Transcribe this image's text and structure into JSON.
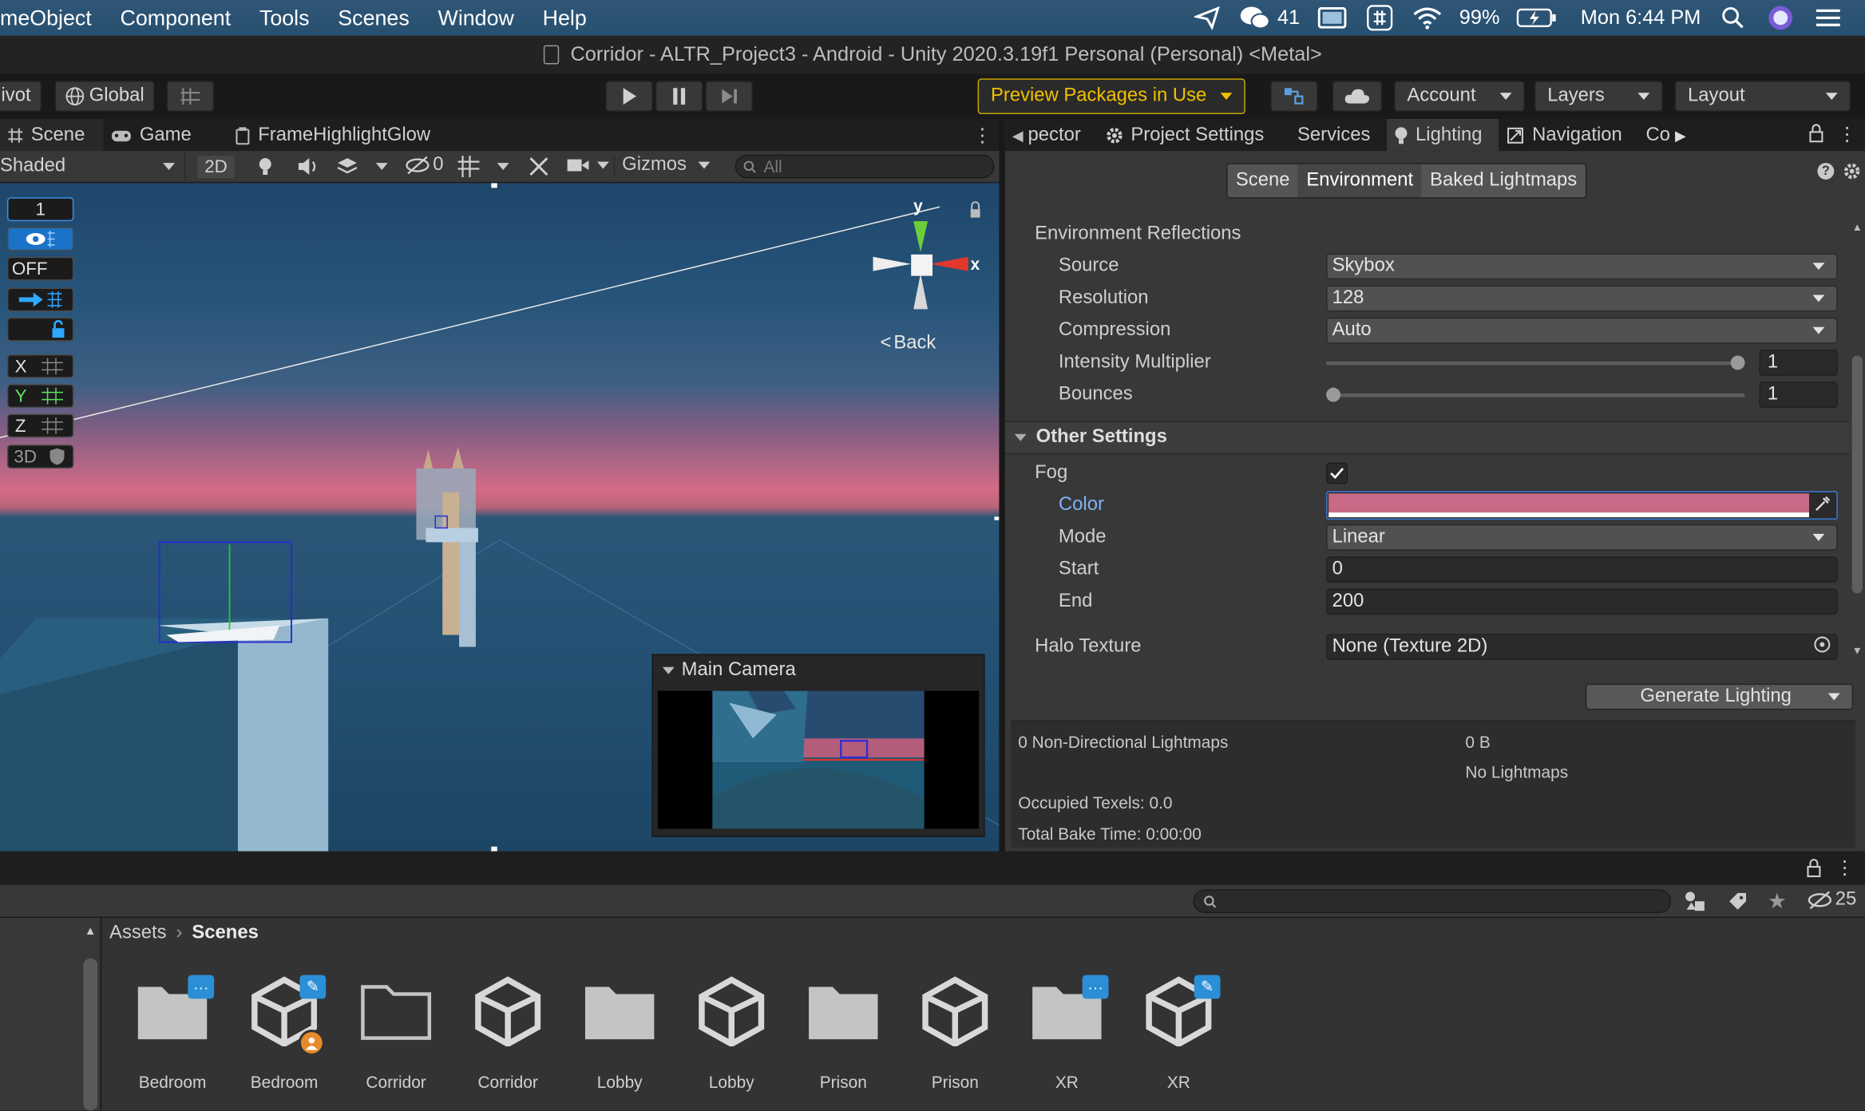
{
  "menubar": {
    "items": [
      "meObject",
      "Component",
      "Tools",
      "Scenes",
      "Window",
      "Help"
    ],
    "wechat_count": "41",
    "battery": "99%",
    "clock": "Mon 6:44 PM"
  },
  "window": {
    "title": "Corridor - ALTR_Project3 - Android - Unity 2020.3.19f1 Personal (Personal) <Metal>"
  },
  "toolbar": {
    "pivot": "ivot",
    "global": "Global",
    "preview_packages": "Preview Packages in Use",
    "account": "Account",
    "layers": "Layers",
    "layout": "Layout"
  },
  "scene_panel": {
    "tabs": [
      "Scene",
      "Game",
      "FrameHighlightGlow"
    ],
    "shading": "Shaded",
    "mode_2d": "2D",
    "hidden_count": "0",
    "gizmos": "Gizmos",
    "search_placeholder": "All",
    "gizmo_back": "Back",
    "axis_y": "y",
    "axis_x": "x",
    "side_buttons": [
      "1",
      "OFF",
      "X",
      "Y",
      "Z",
      "3D"
    ],
    "camera_preview_title": "Main Camera"
  },
  "right_panel": {
    "tabs": [
      "pector",
      "Project Settings",
      "Services",
      "Lighting",
      "Navigation",
      "Co"
    ],
    "subtabs": [
      "Scene",
      "Environment",
      "Baked Lightmaps"
    ],
    "env_reflections": {
      "header": "Environment Reflections",
      "source_label": "Source",
      "source_value": "Skybox",
      "resolution_label": "Resolution",
      "resolution_value": "128",
      "compression_label": "Compression",
      "compression_value": "Auto",
      "intensity_label": "Intensity Multiplier",
      "intensity_value": "1",
      "intensity_level": 1.0,
      "bounces_label": "Bounces",
      "bounces_value": "1",
      "bounces_level": 0.0
    },
    "other_settings": {
      "header": "Other Settings",
      "fog_label": "Fog",
      "fog_enabled": true,
      "color_label": "Color",
      "fog_color": "#c86a87",
      "mode_label": "Mode",
      "mode_value": "Linear",
      "start_label": "Start",
      "start_value": "0",
      "end_label": "End",
      "end_value": "200",
      "halo_label": "Halo Texture",
      "halo_value": "None (Texture 2D)"
    },
    "generate_button": "Generate Lighting",
    "stats": {
      "lightmaps": "0 Non-Directional Lightmaps",
      "size": "0 B",
      "no_lightmaps": "No Lightmaps",
      "occupied": "Occupied Texels: 0.0",
      "bake_time": "Total Bake Time: 0:00:00"
    }
  },
  "project": {
    "hidden_count": "25",
    "breadcrumb": [
      "Assets",
      "Scenes"
    ],
    "assets": [
      {
        "name": "Bedroom",
        "kind": "folder",
        "badge": "dots"
      },
      {
        "name": "Bedroom",
        "kind": "scene",
        "badge": "edit"
      },
      {
        "name": "Corridor",
        "kind": "folder-open",
        "badge": ""
      },
      {
        "name": "Corridor",
        "kind": "scene",
        "badge": ""
      },
      {
        "name": "Lobby",
        "kind": "folder",
        "badge": ""
      },
      {
        "name": "Lobby",
        "kind": "scene",
        "badge": ""
      },
      {
        "name": "Prison",
        "kind": "folder",
        "badge": ""
      },
      {
        "name": "Prison",
        "kind": "scene",
        "badge": ""
      },
      {
        "name": "XR",
        "kind": "folder",
        "badge": "dots"
      },
      {
        "name": "XR",
        "kind": "scene",
        "badge": "edit"
      }
    ]
  },
  "colors": {
    "accent_blue": "#3d7bd8",
    "preview_yellow": "#f0c000",
    "fog_pink": "#c86a87"
  }
}
